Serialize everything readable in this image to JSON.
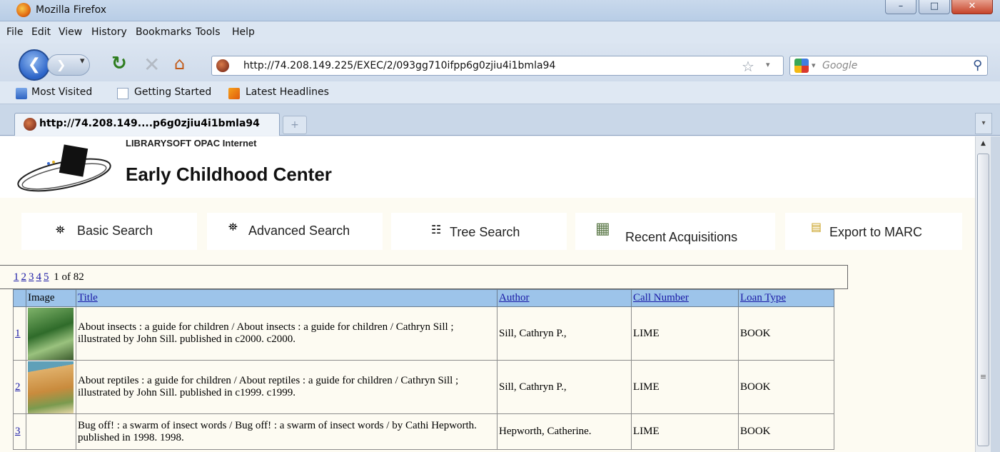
{
  "window": {
    "title": "Mozilla Firefox",
    "min": "–",
    "max": "□",
    "close": "✕"
  },
  "menu": [
    "File",
    "Edit",
    "View",
    "History",
    "Bookmarks",
    "Tools",
    "Help"
  ],
  "nav": {
    "url": "http://74.208.149.225/EXEC/2/093gg710ifpp6g0zjiu4i1bmla94",
    "search_placeholder": "Google"
  },
  "bookmarks": [
    "Most Visited",
    "Getting Started",
    "Latest Headlines"
  ],
  "tabs": [
    {
      "label": "http://74.208.149....p6g0zjiu4i1bmla94"
    }
  ],
  "page": {
    "system": "LIBRARYSOFT OPAC Internet",
    "name": "Early Childhood Center",
    "buttons": [
      "Basic Search",
      "Advanced Search",
      "Tree Search",
      "Recent Acquisitions",
      "Export to MARC"
    ],
    "pager": {
      "pages": [
        "1",
        "2",
        "3",
        "4",
        "5"
      ],
      "status": "1 of 82"
    },
    "columns": [
      "",
      "Image",
      "Title",
      "Author",
      "Call Number",
      "Loan Type"
    ],
    "rows": [
      {
        "num": "1",
        "title": "About insects : a guide for children / About insects : a guide for children / Cathryn Sill ; illustrated by John Sill. published in c2000. c2000.",
        "author": "Sill, Cathryn P.,",
        "call": "LIME",
        "loan": "BOOK"
      },
      {
        "num": "2",
        "title": "About reptiles : a guide for children / About reptiles : a guide for children / Cathryn Sill ; illustrated by John Sill. published in c1999. c1999.",
        "author": "Sill, Cathryn P.,",
        "call": "LIME",
        "loan": "BOOK"
      },
      {
        "num": "3",
        "title": "Bug off! : a swarm of insect words / Bug off! : a swarm of insect words / by Cathi Hepworth. published in 1998. 1998.",
        "author": "Hepworth, Catherine.",
        "call": "LIME",
        "loan": "BOOK"
      }
    ]
  },
  "colors": {
    "header_bg": "#9dc4ea",
    "page_bg": "#fdfbf2",
    "link": "#1a1aa6"
  }
}
